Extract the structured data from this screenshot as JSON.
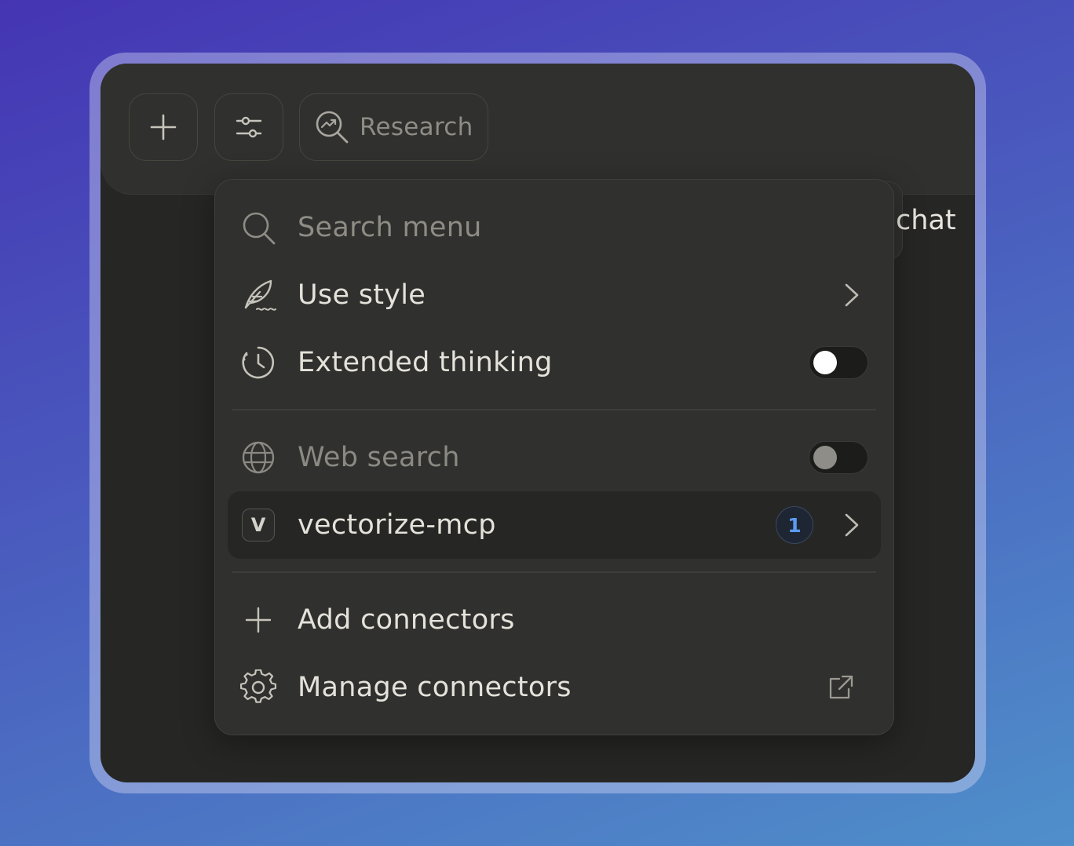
{
  "toolbar": {
    "add_icon": "plus-icon",
    "settings_icon": "sliders-icon",
    "research_label": "Research",
    "research_icon": "research-search-icon"
  },
  "background_chip": {
    "label": "chat"
  },
  "menu": {
    "search": {
      "placeholder": "Search menu",
      "icon": "search-icon"
    },
    "use_style": {
      "label": "Use style",
      "icon": "feather-pen-icon"
    },
    "extended_thinking": {
      "label": "Extended thinking",
      "icon": "clock-icon",
      "enabled": true
    },
    "web_search": {
      "label": "Web search",
      "icon": "globe-icon",
      "enabled": false
    },
    "connector": {
      "letter": "V",
      "label": "vectorize-mcp",
      "badge": "1"
    },
    "add_connectors": {
      "label": "Add connectors",
      "icon": "plus-icon"
    },
    "manage_connectors": {
      "label": "Manage connectors",
      "icon": "gear-icon",
      "trailing_icon": "external-link-icon"
    }
  },
  "colors": {
    "accent_badge": "#5a9cf1",
    "window_bg": "#262624",
    "menu_bg": "#30302e"
  }
}
